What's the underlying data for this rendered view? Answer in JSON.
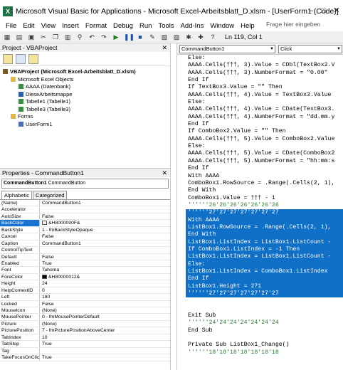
{
  "window": {
    "title": "Microsoft Visual Basic for Applications - Microsoft Excel-Arbeitsblatt_D.xlsm - [UserForm1 (Code)]",
    "app_icon": "excel-icon"
  },
  "menu": {
    "items": [
      "File",
      "Edit",
      "View",
      "Insert",
      "Format",
      "Debug",
      "Run",
      "Tools",
      "Add-Ins",
      "Window",
      "Help"
    ],
    "help_placeholder": "Frage hier eingeben"
  },
  "toolbar": {
    "position": "Ln 119, Col 1"
  },
  "project": {
    "header": "Project - VBAProject",
    "tree": [
      {
        "label": "VBAProject (Microsoft Excel-Arbeitsblatt_D.xlsm)",
        "level": 0,
        "bold": true,
        "icon": "vba-project-icon"
      },
      {
        "label": "Microsoft Excel Objects",
        "level": 1,
        "icon": "folder-icon"
      },
      {
        "label": "AAAA (Datenbank)",
        "level": 2,
        "icon": "sheet-icon"
      },
      {
        "label": "DieseArbeitsmappe",
        "level": 2,
        "icon": "workbook-icon"
      },
      {
        "label": "Tabelle1 (Tabelle1)",
        "level": 2,
        "icon": "sheet-icon"
      },
      {
        "label": "Tabelle3 (Tabelle3)",
        "level": 2,
        "icon": "sheet-icon"
      },
      {
        "label": "Forms",
        "level": 1,
        "icon": "folder-icon"
      },
      {
        "label": "UserForm1",
        "level": 2,
        "icon": "form-icon"
      }
    ]
  },
  "properties": {
    "header": "Properties - CommandButton1",
    "object_name": "CommandButton1",
    "object_type": "CommandButton",
    "tabs": [
      "Alphabetic",
      "Categorized"
    ],
    "rows": [
      {
        "name": "(Name)",
        "value": "CommandButton1"
      },
      {
        "name": "Accelerator",
        "value": ""
      },
      {
        "name": "AutoSize",
        "value": "False"
      },
      {
        "name": "BackColor",
        "value": "&H8000000F&",
        "swatch": "#f0f0f0",
        "selected": true
      },
      {
        "name": "BackStyle",
        "value": "1 - fmBackStyleOpaque"
      },
      {
        "name": "Cancel",
        "value": "False"
      },
      {
        "name": "Caption",
        "value": "CommandButton1"
      },
      {
        "name": "ControlTipText",
        "value": ""
      },
      {
        "name": "Default",
        "value": "False"
      },
      {
        "name": "Enabled",
        "value": "True"
      },
      {
        "name": "Font",
        "value": "Tahoma"
      },
      {
        "name": "ForeColor",
        "value": "&H80000012&",
        "swatch": "#000000"
      },
      {
        "name": "Height",
        "value": "24"
      },
      {
        "name": "HelpContextID",
        "value": "0"
      },
      {
        "name": "Left",
        "value": "180"
      },
      {
        "name": "Locked",
        "value": "False"
      },
      {
        "name": "MouseIcon",
        "value": "(None)"
      },
      {
        "name": "MousePointer",
        "value": "0 - fmMousePointerDefault"
      },
      {
        "name": "Picture",
        "value": "(None)"
      },
      {
        "name": "PicturePosition",
        "value": "7 - fmPicturePositionAboveCenter"
      },
      {
        "name": "TabIndex",
        "value": "10"
      },
      {
        "name": "TabStop",
        "value": "True"
      },
      {
        "name": "Tag",
        "value": ""
      },
      {
        "name": "TakeFocusOnClick",
        "value": "True"
      }
    ]
  },
  "code": {
    "object_combo": "CommandButton1",
    "proc_combo": "Click",
    "lines": [
      {
        "t": "Else:",
        "s": ""
      },
      {
        "t": "AAAA.Cells(†††, 3).Value = CDbl(TextBox2.V",
        "s": ""
      },
      {
        "t": "AAAA.Cells(†††, 3).NumberFormat = \"0.00\"",
        "s": ""
      },
      {
        "t": "End If",
        "s": ""
      },
      {
        "t": "If TextBox3.Value = \"\" Then",
        "s": ""
      },
      {
        "t": "AAAA.Cells(†††, 4).Value = TextBox3.Value",
        "s": ""
      },
      {
        "t": "Else:",
        "s": ""
      },
      {
        "t": "AAAA.Cells(†††, 4).Value = CDate(TextBox3.",
        "s": ""
      },
      {
        "t": "AAAA.Cells(†††, 4).NumberFormat = \"dd.mm.y",
        "s": ""
      },
      {
        "t": "End If",
        "s": ""
      },
      {
        "t": "If ComboBox2.Value = \"\" Then",
        "s": ""
      },
      {
        "t": "AAAA.Cells(†††, 5).Value = ComboBox2.Value",
        "s": ""
      },
      {
        "t": "Else:",
        "s": ""
      },
      {
        "t": "AAAA.Cells(†††, 5).Value = CDate(ComboBox2",
        "s": ""
      },
      {
        "t": "AAAA.Cells(†††, 5).NumberFormat = \"hh:mm:s",
        "s": ""
      },
      {
        "t": "End If",
        "s": ""
      },
      {
        "t": "With AAAA",
        "s": ""
      },
      {
        "t": "ComboBox1.RowSource = .Range(.Cells(2, 1),",
        "s": ""
      },
      {
        "t": "End With",
        "s": ""
      },
      {
        "t": "ComboBox1.Value = ††† - 1",
        "s": ""
      },
      {
        "t": "''''''26'26'26'26'26'26'26",
        "s": "cm"
      },
      {
        "t": "''''''27'27'27'27'27'27'27",
        "s": "hl"
      },
      {
        "t": "With AAAA",
        "s": "hl"
      },
      {
        "t": "ListBox1.RowSource = .Range(.Cells(2, 1),",
        "s": "hl"
      },
      {
        "t": "End With",
        "s": "hl"
      },
      {
        "t": "ListBox1.ListIndex = ListBox1.ListCount -",
        "s": "hl"
      },
      {
        "t": "If ComboBox1.ListIndex = -1 Then",
        "s": "hl"
      },
      {
        "t": "ListBox1.ListIndex = ListBox1.ListCount -",
        "s": "hl"
      },
      {
        "t": "Else:",
        "s": "hl"
      },
      {
        "t": "ListBox1.ListIndex = ComboBox1.ListIndex",
        "s": "hl"
      },
      {
        "t": "End If",
        "s": "hl"
      },
      {
        "t": "ListBox1.Height = 271",
        "s": "hl"
      },
      {
        "t": "''''''27'27'27'27'27'27'27",
        "s": "hl"
      },
      {
        "t": "",
        "s": ""
      },
      {
        "t": "",
        "s": ""
      },
      {
        "t": "Exit Sub",
        "s": ""
      },
      {
        "t": "''''''24'24'24'24'24'24'24",
        "s": "cm"
      },
      {
        "t": "End Sub",
        "s": ""
      },
      {
        "t": "",
        "s": ""
      },
      {
        "t": "Private Sub ListBox1_Change()",
        "s": ""
      },
      {
        "t": "''''''18'18'18'18'18'18'18",
        "s": "cm"
      }
    ]
  }
}
